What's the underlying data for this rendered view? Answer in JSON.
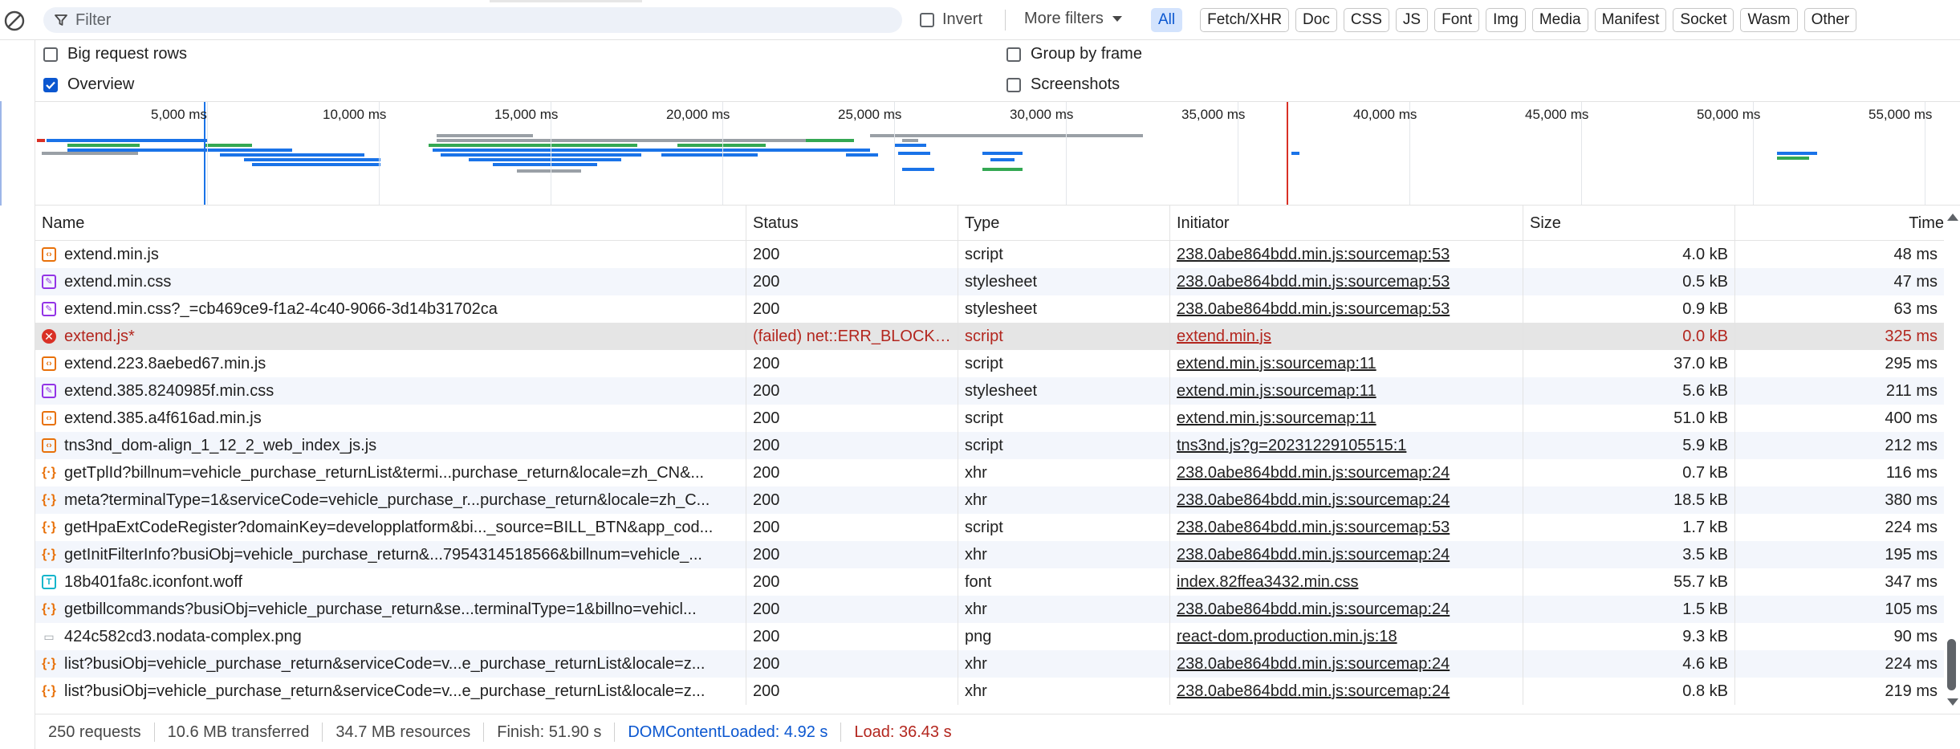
{
  "toolbar": {
    "filter_placeholder": "Filter",
    "invert_label": "Invert",
    "more_filters_label": "More filters",
    "chips": [
      "All",
      "Fetch/XHR",
      "Doc",
      "CSS",
      "JS",
      "Font",
      "Img",
      "Media",
      "Manifest",
      "Socket",
      "Wasm",
      "Other"
    ],
    "active_chip": "All"
  },
  "settings": {
    "big_request_rows": {
      "label": "Big request rows",
      "checked": false
    },
    "overview": {
      "label": "Overview",
      "checked": true
    },
    "group_by_frame": {
      "label": "Group by frame",
      "checked": false
    },
    "screenshots": {
      "label": "Screenshots",
      "checked": false
    }
  },
  "overview": {
    "ticks": [
      "5,000 ms",
      "10,000 ms",
      "15,000 ms",
      "20,000 ms",
      "25,000 ms",
      "30,000 ms",
      "35,000 ms",
      "40,000 ms",
      "45,000 ms",
      "50,000 ms",
      "55,000 ms"
    ],
    "dom_content_loaded_ms": 4920,
    "load_ms": 36430,
    "colors": {
      "dcl": "#1a73e8",
      "load": "#d93025",
      "bar_blue": "#1a73e8",
      "bar_green": "#34a853",
      "bar_gray": "#9aa0a6"
    }
  },
  "table": {
    "columns": {
      "name": "Name",
      "status": "Status",
      "type": "Type",
      "initiator": "Initiator",
      "size": "Size",
      "time": "Time"
    },
    "rows": [
      {
        "icon": "script",
        "name": "extend.min.js",
        "status": "200",
        "type": "script",
        "initiator": "238.0abe864bdd.min.js:sourcemap:53",
        "size": "4.0 kB",
        "time": "48 ms"
      },
      {
        "icon": "stylesheet",
        "name": "extend.min.css",
        "status": "200",
        "type": "stylesheet",
        "initiator": "238.0abe864bdd.min.js:sourcemap:53",
        "size": "0.5 kB",
        "time": "47 ms"
      },
      {
        "icon": "stylesheet",
        "name": "extend.min.css?_=cb469ce9-f1a2-4c40-9066-3d14b31702ca",
        "status": "200",
        "type": "stylesheet",
        "initiator": "238.0abe864bdd.min.js:sourcemap:53",
        "size": "0.9 kB",
        "time": "63 ms"
      },
      {
        "icon": "error",
        "name": "extend.js*",
        "status": "(failed) net::ERR_BLOCKE...",
        "type": "script",
        "initiator": "extend.min.js",
        "size": "0.0 kB",
        "time": "325 ms",
        "error": true
      },
      {
        "icon": "script",
        "name": "extend.223.8aebed67.min.js",
        "status": "200",
        "type": "script",
        "initiator": "extend.min.js:sourcemap:11",
        "size": "37.0 kB",
        "time": "295 ms"
      },
      {
        "icon": "stylesheet",
        "name": "extend.385.8240985f.min.css",
        "status": "200",
        "type": "stylesheet",
        "initiator": "extend.min.js:sourcemap:11",
        "size": "5.6 kB",
        "time": "211 ms"
      },
      {
        "icon": "script",
        "name": "extend.385.a4f616ad.min.js",
        "status": "200",
        "type": "script",
        "initiator": "extend.min.js:sourcemap:11",
        "size": "51.0 kB",
        "time": "400 ms"
      },
      {
        "icon": "script",
        "name": "tns3nd_dom-align_1_12_2_web_index_js.js",
        "status": "200",
        "type": "script",
        "initiator": "tns3nd.js?g=20231229105515:1",
        "size": "5.9 kB",
        "time": "212 ms"
      },
      {
        "icon": "xhr",
        "name": "getTplId?billnum=vehicle_purchase_returnList&termi...purchase_return&locale=zh_CN&...",
        "status": "200",
        "type": "xhr",
        "initiator": "238.0abe864bdd.min.js:sourcemap:24",
        "size": "0.7 kB",
        "time": "116 ms"
      },
      {
        "icon": "xhr",
        "name": "meta?terminalType=1&serviceCode=vehicle_purchase_r...purchase_return&locale=zh_C...",
        "status": "200",
        "type": "xhr",
        "initiator": "238.0abe864bdd.min.js:sourcemap:24",
        "size": "18.5 kB",
        "time": "380 ms"
      },
      {
        "icon": "xhr",
        "name": "getHpaExtCodeRegister?domainKey=developplatform&bi..._source=BILL_BTN&app_cod...",
        "status": "200",
        "type": "script",
        "initiator": "238.0abe864bdd.min.js:sourcemap:53",
        "size": "1.7 kB",
        "time": "224 ms"
      },
      {
        "icon": "xhr",
        "name": "getInitFilterInfo?busiObj=vehicle_purchase_return&...7954314518566&billnum=vehicle_...",
        "status": "200",
        "type": "xhr",
        "initiator": "238.0abe864bdd.min.js:sourcemap:24",
        "size": "3.5 kB",
        "time": "195 ms"
      },
      {
        "icon": "font",
        "name": "18b401fa8c.iconfont.woff",
        "status": "200",
        "type": "font",
        "initiator": "index.82ffea3432.min.css",
        "size": "55.7 kB",
        "time": "347 ms"
      },
      {
        "icon": "xhr",
        "name": "getbillcommands?busiObj=vehicle_purchase_return&se...terminalType=1&billno=vehicl...",
        "status": "200",
        "type": "xhr",
        "initiator": "238.0abe864bdd.min.js:sourcemap:24",
        "size": "1.5 kB",
        "time": "105 ms"
      },
      {
        "icon": "png",
        "name": "424c582cd3.nodata-complex.png",
        "status": "200",
        "type": "png",
        "initiator": "react-dom.production.min.js:18",
        "size": "9.3 kB",
        "time": "90 ms"
      },
      {
        "icon": "xhr",
        "name": "list?busiObj=vehicle_purchase_return&serviceCode=v...e_purchase_returnList&locale=z...",
        "status": "200",
        "type": "xhr",
        "initiator": "238.0abe864bdd.min.js:sourcemap:24",
        "size": "4.6 kB",
        "time": "224 ms"
      },
      {
        "icon": "xhr",
        "name": "list?busiObj=vehicle_purchase_return&serviceCode=v...e_purchase_returnList&locale=z...",
        "status": "200",
        "type": "xhr",
        "initiator": "238.0abe864bdd.min.js:sourcemap:24",
        "size": "0.8 kB",
        "time": "219 ms"
      }
    ]
  },
  "status": {
    "requests": "250 requests",
    "transferred": "10.6 MB transferred",
    "resources": "34.7 MB resources",
    "finish": "Finish: 51.90 s",
    "dcl": "DOMContentLoaded: 4.92 s",
    "load": "Load: 36.43 s"
  }
}
